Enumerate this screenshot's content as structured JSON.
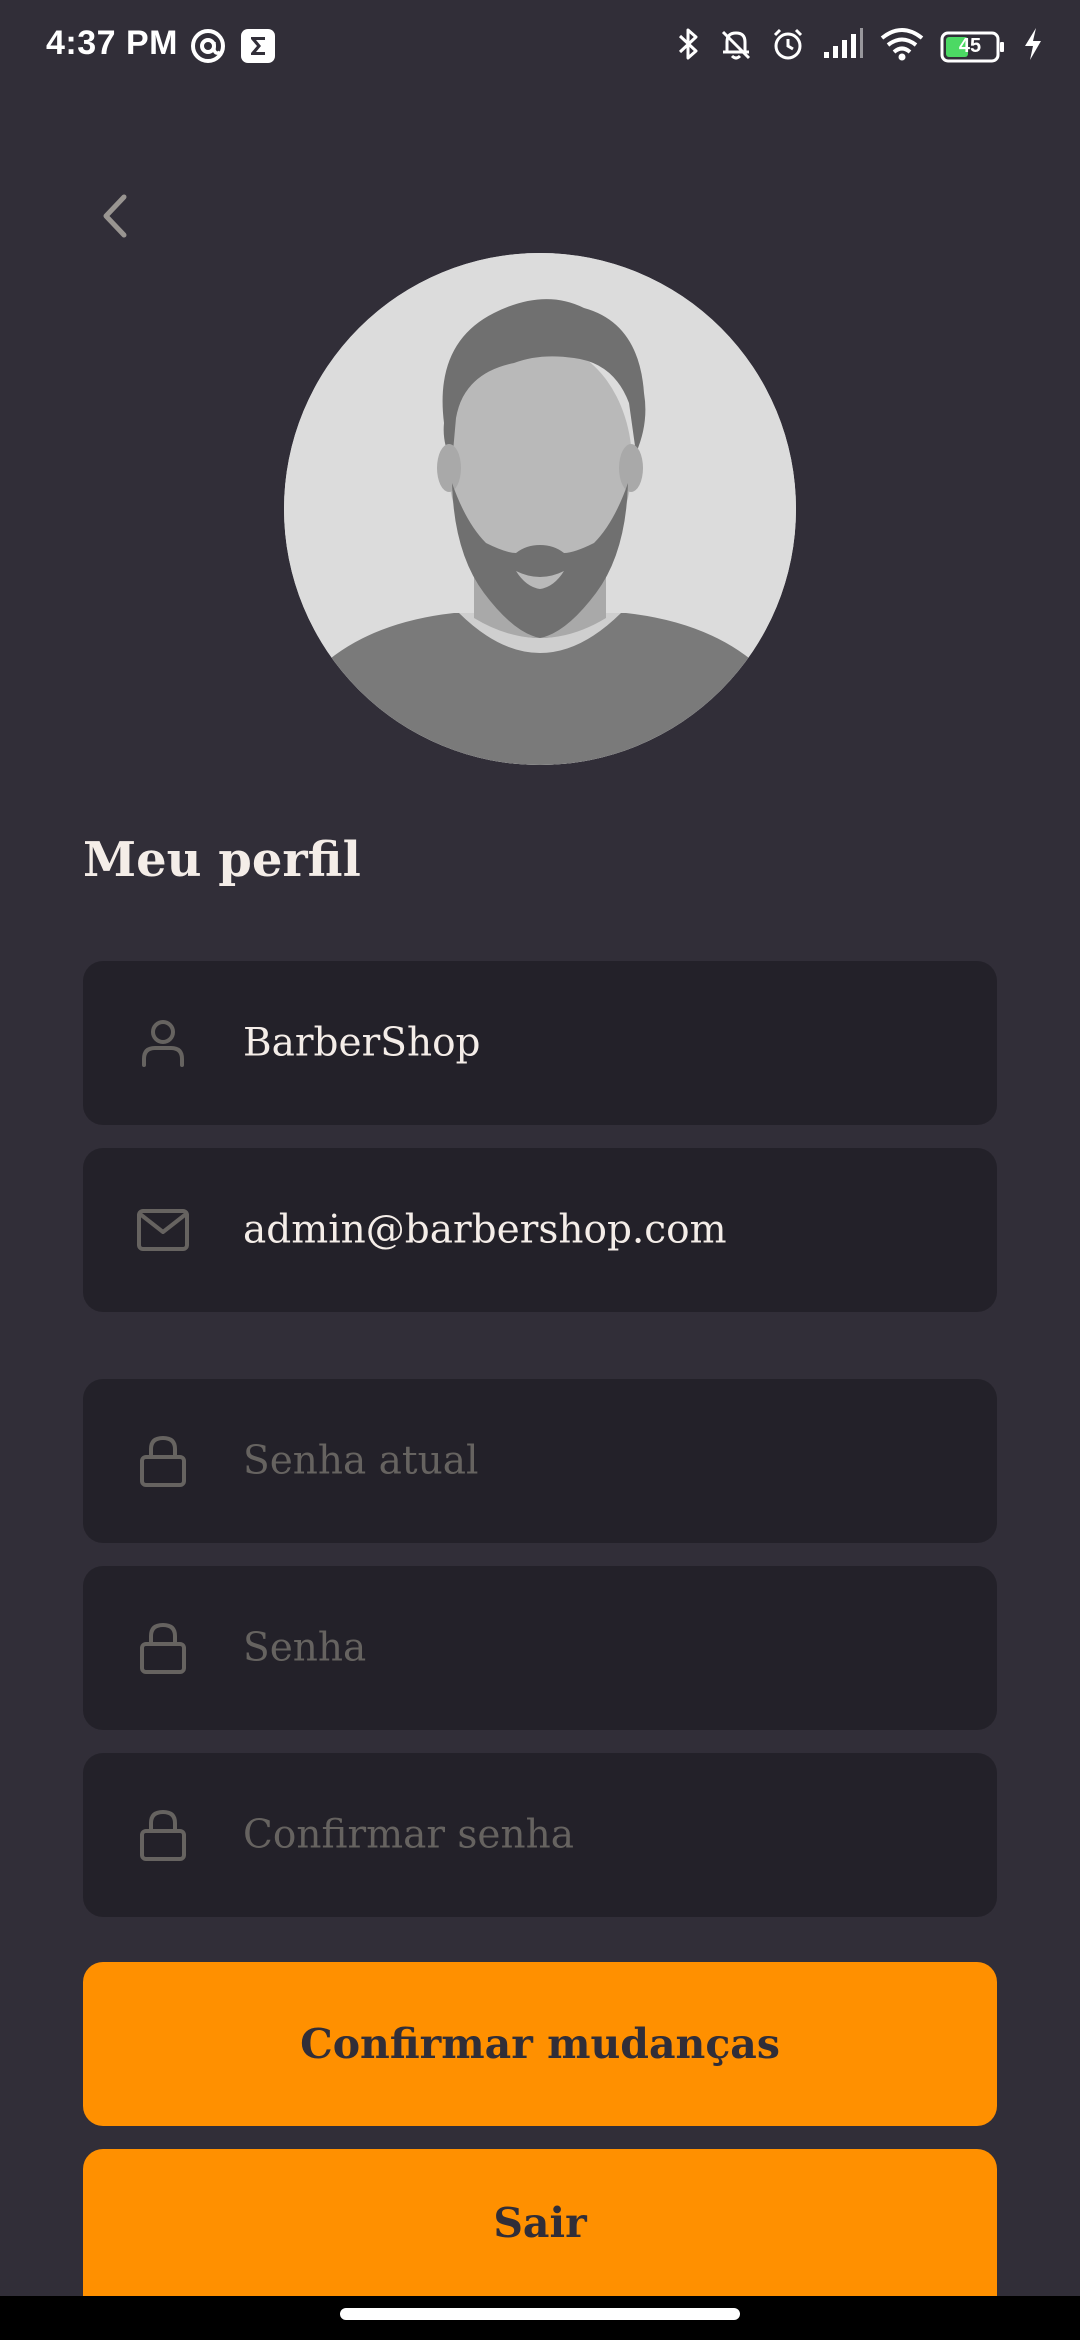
{
  "status_bar": {
    "time": "4:37 PM",
    "left_icons": [
      "at-sign-icon",
      "sigma-icon"
    ],
    "right_icons": [
      "bluetooth-icon",
      "mute-icon",
      "alarm-icon",
      "signal-icon",
      "wifi-icon",
      "battery-icon",
      "charging-icon"
    ],
    "battery_level": "45"
  },
  "header": {
    "back_icon": "chevron-left-icon"
  },
  "profile": {
    "title": "Meu perfil",
    "avatar_icon": "avatar-placeholder-icon"
  },
  "form": {
    "name_value": "BarberShop",
    "name_icon": "user-icon",
    "email_value": "admin@barbershop.com",
    "email_icon": "mail-icon",
    "current_password_placeholder": "Senha atual",
    "new_password_placeholder": "Senha",
    "confirm_password_placeholder": "Confirmar senha",
    "lock_icon": "lock-icon"
  },
  "buttons": {
    "confirm_label": "Confirmar mudanças",
    "logout_label": "Sair"
  },
  "colors": {
    "background": "#312e38",
    "input_background": "#232129",
    "accent": "#ff9000",
    "text": "#f4ede8",
    "placeholder": "#666360",
    "icon": "#666360"
  }
}
